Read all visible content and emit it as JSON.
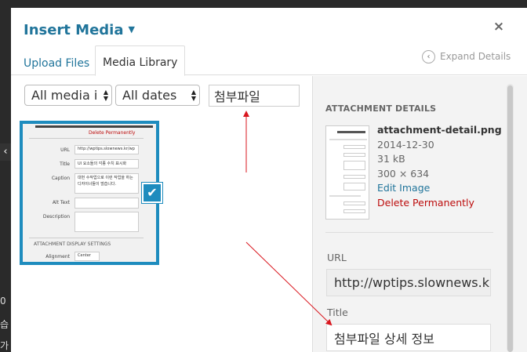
{
  "modal": {
    "title": "Insert Media",
    "title_caret": "▼",
    "close_glyph": "×"
  },
  "tabs": [
    {
      "label": "Upload Files"
    },
    {
      "label": "Media Library",
      "active": true
    }
  ],
  "expand_details": {
    "label": "Expand Details",
    "glyph": "‹"
  },
  "filters": {
    "type": "All media i",
    "date": "All dates",
    "search_value": "첨부파일"
  },
  "attachment_thumb": {
    "delete": "Delete Permanently",
    "url_label": "URL",
    "url_value": "http://wptips.slownews.kr/wp",
    "title_label": "Title",
    "title_value": "UI 요소들의 각종 수치 표시화",
    "caption_label": "Caption",
    "caption_value": "대번 수작업으로 이런 작업을 하는 디자이너들이 많습니다.",
    "alt_label": "Alt Text",
    "description_label": "Description",
    "display_heading": "ATTACHMENT DISPLAY SETTINGS",
    "alignment_label": "Alignment",
    "alignment_value": "Center"
  },
  "check_glyph": "✔",
  "details": {
    "heading": "Attachment Details",
    "filename": "attachment-detail.png",
    "date": "2014-12-30",
    "size": "31 kB",
    "dimensions": "300 × 634",
    "edit_link": "Edit Image",
    "delete_link": "Delete Permanently"
  },
  "fields": {
    "url_label": "URL",
    "url_value": "http://wptips.slownews.kr/wp",
    "title_label": "Title",
    "title_value": "첨부파일 상세 정보"
  },
  "background": {
    "arrow": "‹",
    "chars": [
      "0",
      "습",
      "가"
    ]
  },
  "colors": {
    "accent": "#21759b",
    "selection": "#1e8cbe",
    "danger": "#bc0b0b",
    "annotation": "#d9161e"
  }
}
